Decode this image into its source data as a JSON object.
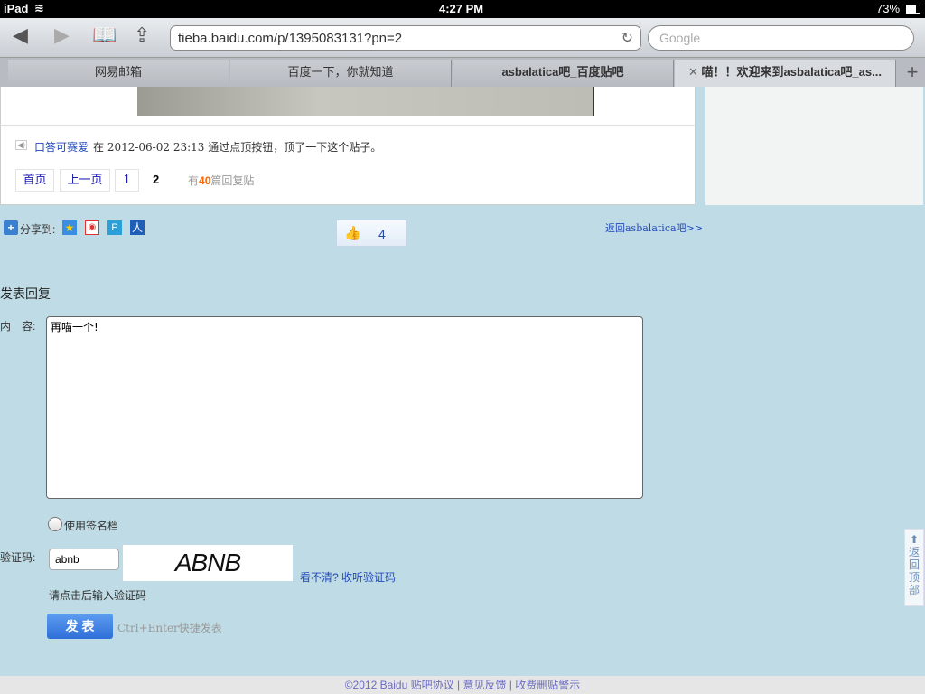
{
  "status": {
    "device": "iPad",
    "time": "4:27 PM",
    "battery": "73%"
  },
  "browser": {
    "url": "tieba.baidu.com/p/1395083131?pn=2",
    "search_placeholder": "Google",
    "tabs": [
      {
        "label": "网易邮箱"
      },
      {
        "label": "百度一下，你就知道"
      },
      {
        "label": "asbalatica吧_百度贴吧"
      },
      {
        "label": "喵！！欢迎来到asbalatica吧_as..."
      }
    ]
  },
  "post": {
    "user": "口答可赛爱",
    "text": "在 2012-06-02 23:13 通过点顶按钮，顶了一下这个贴子。"
  },
  "pagination": {
    "first": "首页",
    "prev": "上一页",
    "page1": "1",
    "current": "2",
    "count_prefix": "有",
    "count": "40",
    "count_suffix": "篇回复贴"
  },
  "share": {
    "label": "分享到:",
    "like_count": "4",
    "back_link": "返回asbalatica吧>>"
  },
  "reply": {
    "title": "发表回复",
    "content_label": "内　容:",
    "content": "再喵一个!",
    "signature_label": "使用签名档",
    "captcha_label": "验证码:",
    "captcha_value": "abnb",
    "captcha_image_text": "ABNB",
    "captcha_help": "看不清? 收听验证码",
    "captcha_hint": "请点击后输入验证码",
    "submit": "发 表",
    "shortcut": "Ctrl+Enter快捷发表"
  },
  "back_top": "返回顶部",
  "footer": {
    "copyright": "©2012 Baidu",
    "agreement": "贴吧协议",
    "feedback": "意见反馈",
    "warning": "收费删贴警示"
  }
}
